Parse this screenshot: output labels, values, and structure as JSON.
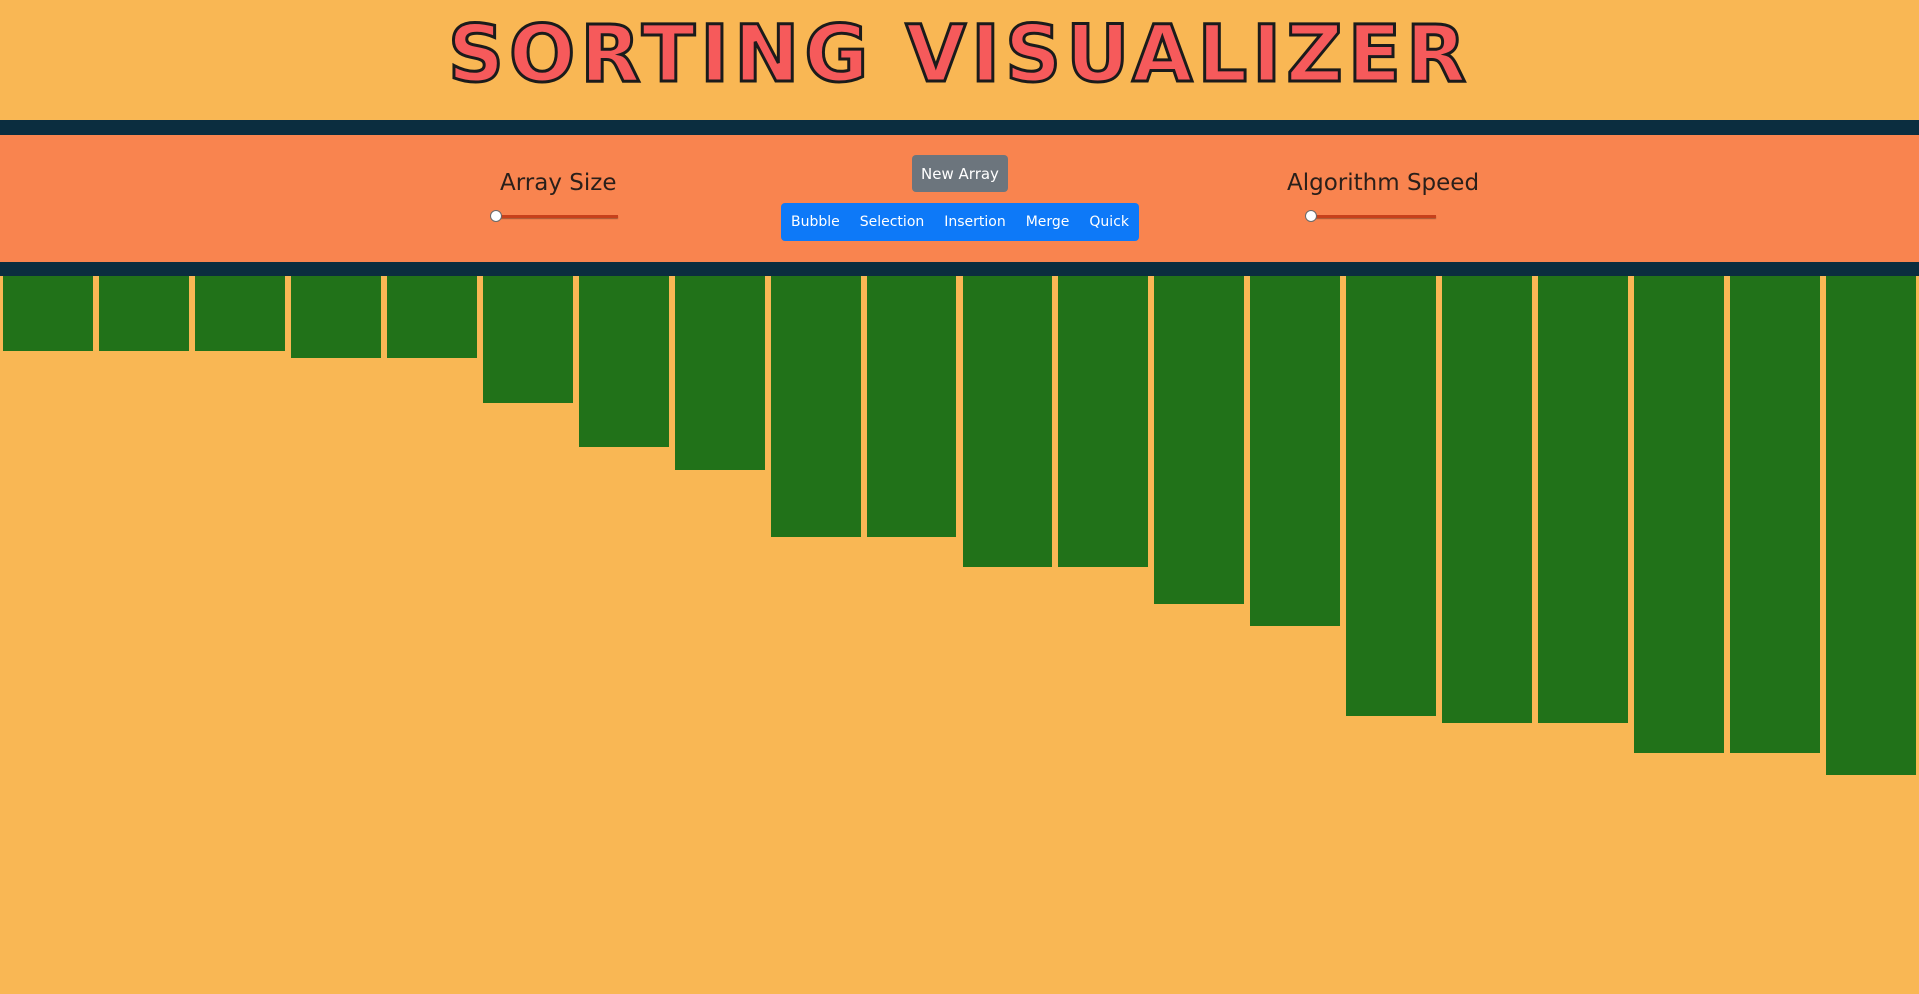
{
  "header": {
    "title": "SORTING VISUALIZER"
  },
  "controls": {
    "array_size_label": "Array Size",
    "array_size_value": 0,
    "speed_label": "Algorithm Speed",
    "speed_value": 0,
    "new_array_label": "New Array",
    "algorithms": [
      "Bubble",
      "Selection",
      "Insertion",
      "Merge",
      "Quick"
    ]
  },
  "array": {
    "bar_color": "#217219",
    "values": [
      75,
      75,
      75,
      82,
      82,
      127,
      171,
      194,
      261,
      261,
      291,
      291,
      328,
      350,
      440,
      447,
      447,
      477,
      477,
      499
    ]
  },
  "colors": {
    "background": "#f9b754",
    "control_band": "#f9844f",
    "rule": "#0b2d3f",
    "title": "#f65a5b",
    "new_array_button": "#6c757d",
    "algorithm_group": "#0d79f8",
    "slider_track": "#c7401b"
  }
}
